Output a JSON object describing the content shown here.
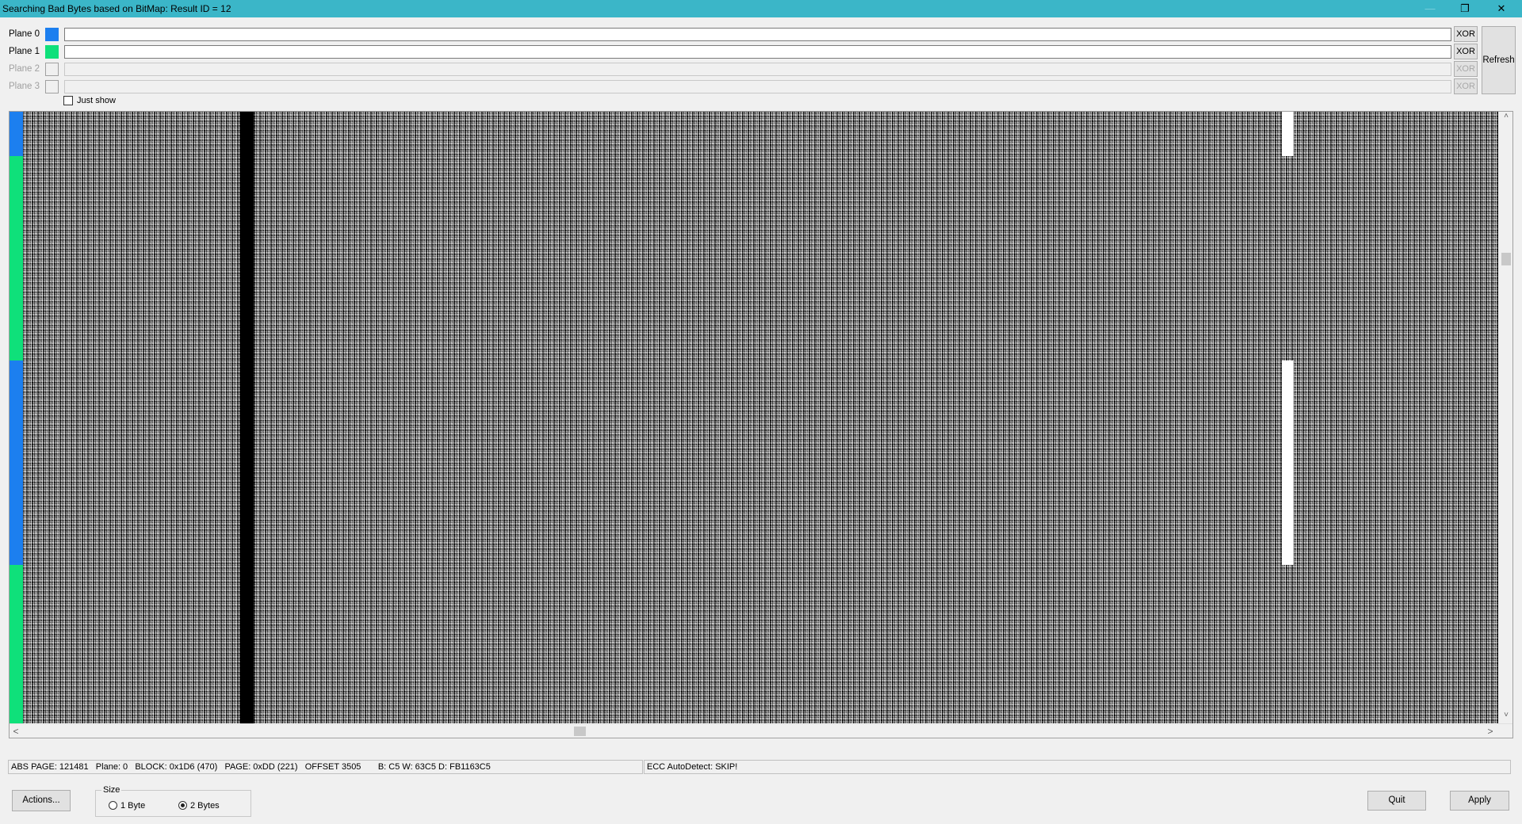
{
  "window": {
    "title": "Searching Bad Bytes based on BitMap: Result ID = 12",
    "controls": {
      "minimize": "—",
      "maximize": "❐",
      "close": "✕"
    }
  },
  "planes": [
    {
      "label": "Plane 0",
      "color": "#1c7fef",
      "enabled": true,
      "xor_label": "XOR"
    },
    {
      "label": "Plane 1",
      "color": "#0fe07a",
      "enabled": true,
      "xor_label": "XOR"
    },
    {
      "label": "Plane 2",
      "color": "",
      "enabled": false,
      "xor_label": "XOR"
    },
    {
      "label": "Plane 3",
      "color": "",
      "enabled": false,
      "xor_label": "XOR"
    }
  ],
  "refresh_label": "Refresh",
  "just_show": {
    "label": "Just show",
    "checked": false
  },
  "bitmap": {
    "plane_colors": [
      "#1c7fef",
      "#0fe07a",
      "#1c7fef",
      "#0fe07a"
    ]
  },
  "status": {
    "left": "ABS PAGE: 121481   Plane: 0   BLOCK: 0x1D6 (470)   PAGE: 0xDD (221)   OFFSET 3505       B: C5 W: 63C5 D: FB1163C5",
    "right": "ECC AutoDetect: SKIP!"
  },
  "buttons": {
    "actions": "Actions...",
    "quit": "Quit",
    "apply": "Apply"
  },
  "size": {
    "legend": "Size",
    "options": [
      {
        "label": "1 Byte",
        "selected": false
      },
      {
        "label": "2 Bytes",
        "selected": true
      }
    ]
  },
  "scroll": {
    "up": "˄",
    "down": "˅",
    "left": "<",
    "right": ">"
  }
}
